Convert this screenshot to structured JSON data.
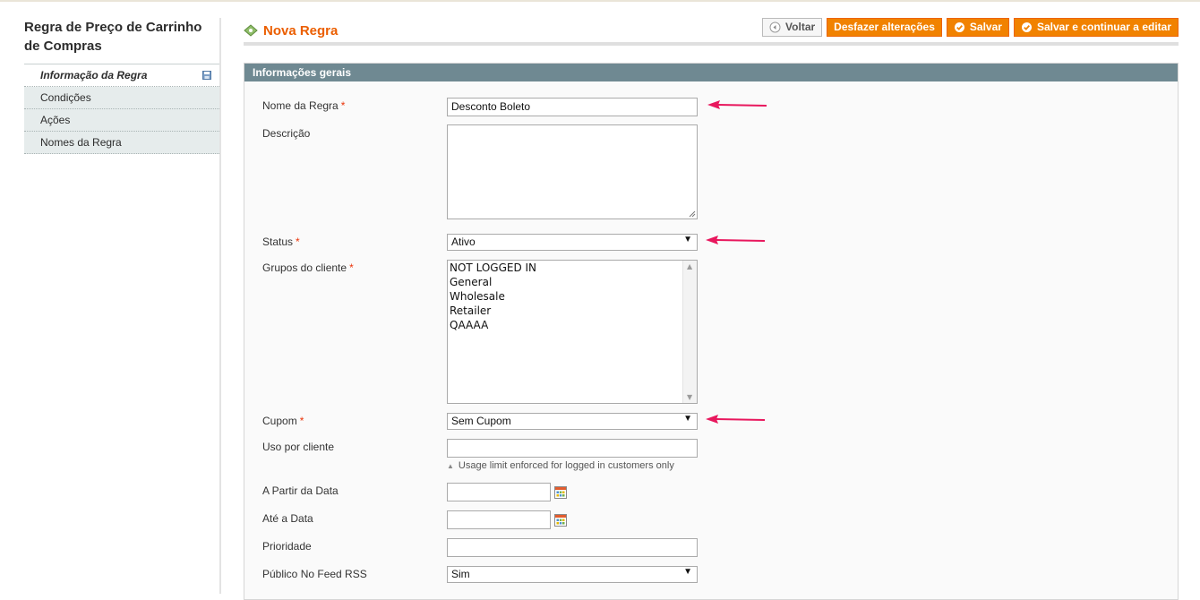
{
  "sidebar": {
    "title": "Regra de Preço de Carrinho de Compras",
    "tabs": [
      {
        "label": "Informação da Regra",
        "active": true
      },
      {
        "label": "Condições"
      },
      {
        "label": "Ações"
      },
      {
        "label": "Nomes da Regra"
      }
    ]
  },
  "header": {
    "title": "Nova Regra",
    "buttons": {
      "back": "Voltar",
      "reset": "Desfazer alterações",
      "save": "Salvar",
      "save_continue": "Salvar e continuar a editar"
    }
  },
  "form": {
    "legend": "Informações gerais",
    "name": {
      "label": "Nome da Regra",
      "required": "*",
      "value": "Desconto Boleto"
    },
    "description": {
      "label": "Descrição",
      "value": ""
    },
    "status": {
      "label": "Status",
      "required": "*",
      "value": "Ativo"
    },
    "customer_groups": {
      "label": "Grupos do cliente",
      "required": "*",
      "options": [
        "NOT LOGGED IN",
        "General",
        "Wholesale",
        "Retailer",
        "QAAAA"
      ]
    },
    "coupon": {
      "label": "Cupom",
      "required": "*",
      "value": "Sem Cupom"
    },
    "uses_per_customer": {
      "label": "Uso por cliente",
      "value": "",
      "note": "Usage limit enforced for logged in customers only"
    },
    "from_date": {
      "label": "A Partir da Data",
      "value": ""
    },
    "to_date": {
      "label": "Até a Data",
      "value": ""
    },
    "priority": {
      "label": "Prioridade",
      "value": ""
    },
    "rss": {
      "label": "Público No Feed RSS",
      "value": "Sim"
    }
  },
  "colors": {
    "accent": "#eb5e00",
    "button": "#f18200",
    "legend_bar": "#6f8992",
    "annotation_arrow": "#e8175d"
  }
}
